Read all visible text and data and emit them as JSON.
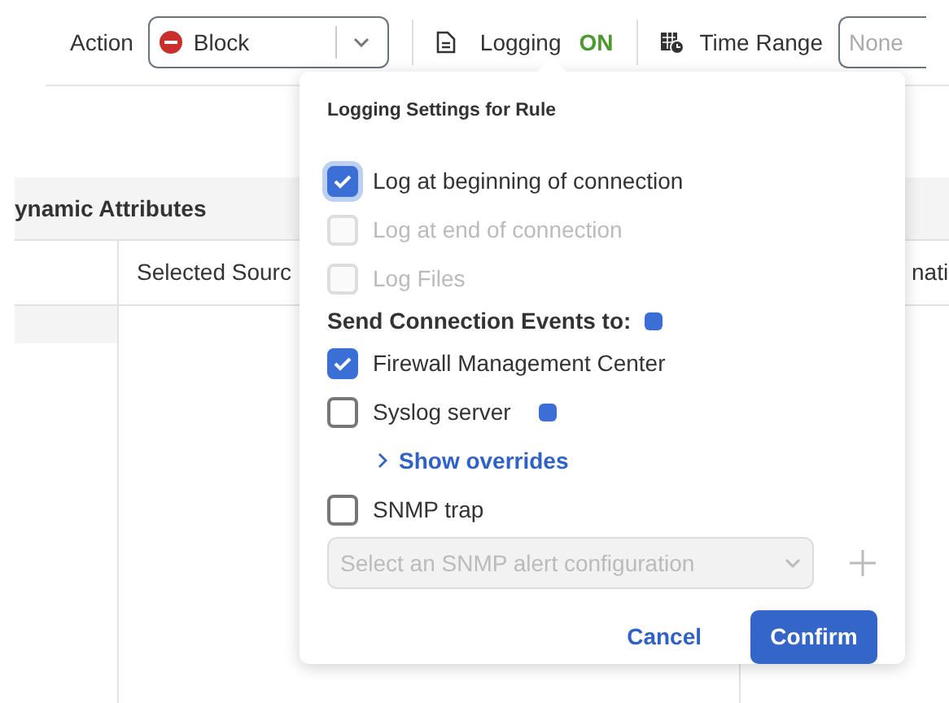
{
  "toolbar": {
    "action_label": "Action",
    "action_value": "Block",
    "logging_label": "Logging",
    "logging_state": "ON",
    "time_range_label": "Time Range",
    "time_range_placeholder": "None"
  },
  "table": {
    "header": "ynamic Attributes",
    "row": [
      "Selected Sourc",
      "nati"
    ]
  },
  "popover": {
    "title": "Logging Settings for Rule",
    "options": [
      {
        "label": "Log at beginning of connection",
        "checked": true,
        "disabled": false
      },
      {
        "label": "Log at end of connection",
        "checked": false,
        "disabled": true
      },
      {
        "label": "Log Files",
        "checked": false,
        "disabled": true
      }
    ],
    "section_title": "Send Connection Events to:",
    "destinations": [
      {
        "label": "Firewall Management Center",
        "checked": true
      },
      {
        "label": "Syslog server",
        "checked": false,
        "info": true,
        "link": "Show overrides"
      },
      {
        "label": "SNMP trap",
        "checked": false,
        "select_placeholder": "Select an SNMP alert configuration"
      }
    ],
    "buttons": [
      {
        "label": "Cancel",
        "kind": "link"
      },
      {
        "label": "Confirm",
        "kind": "primary"
      }
    ]
  }
}
